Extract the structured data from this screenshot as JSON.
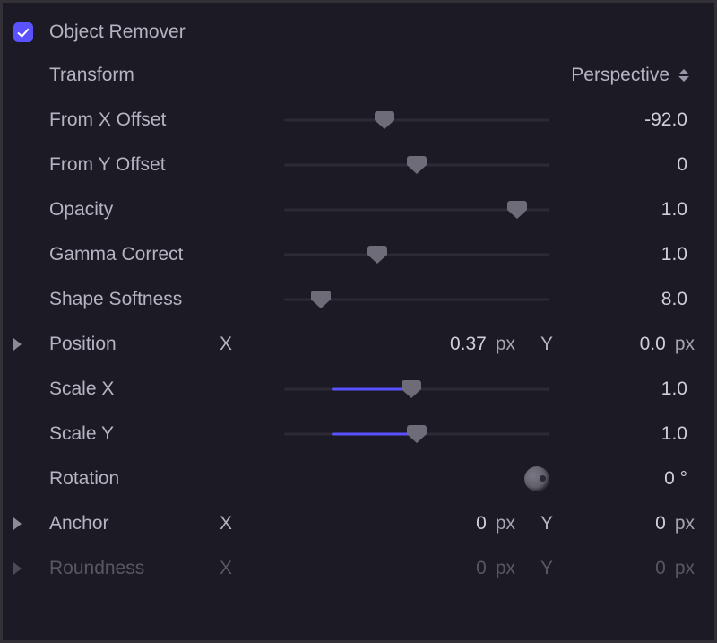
{
  "header": {
    "title": "Object Remover",
    "checked": true
  },
  "params": {
    "transform": {
      "label": "Transform",
      "value": "Perspective"
    },
    "from_x_offset": {
      "label": "From X Offset",
      "value": "-92.0",
      "pos": 38
    },
    "from_y_offset": {
      "label": "From Y Offset",
      "value": "0",
      "pos": 50
    },
    "opacity": {
      "label": "Opacity",
      "value": "1.0",
      "pos": 88
    },
    "gamma_correct": {
      "label": "Gamma Correct",
      "value": "1.0",
      "pos": 35
    },
    "shape_softness": {
      "label": "Shape Softness",
      "value": "8.0",
      "pos": 14
    },
    "position": {
      "label": "Position",
      "x_label": "X",
      "x_value": "0.37",
      "x_unit": "px",
      "y_label": "Y",
      "y_value": "0.0",
      "y_unit": "px"
    },
    "scale_x": {
      "label": "Scale X",
      "value": "1.0",
      "pos": 48,
      "fill_from": 18,
      "fill_to": 48
    },
    "scale_y": {
      "label": "Scale Y",
      "value": "1.0",
      "pos": 50,
      "fill_from": 18,
      "fill_to": 50
    },
    "rotation": {
      "label": "Rotation",
      "value": "0",
      "unit": "°"
    },
    "anchor": {
      "label": "Anchor",
      "x_label": "X",
      "x_value": "0",
      "x_unit": "px",
      "y_label": "Y",
      "y_value": "0",
      "y_unit": "px"
    },
    "roundness": {
      "label": "Roundness",
      "x_label": "X",
      "x_value": "0",
      "x_unit": "px",
      "y_label": "Y",
      "y_value": "0",
      "y_unit": "px"
    }
  }
}
